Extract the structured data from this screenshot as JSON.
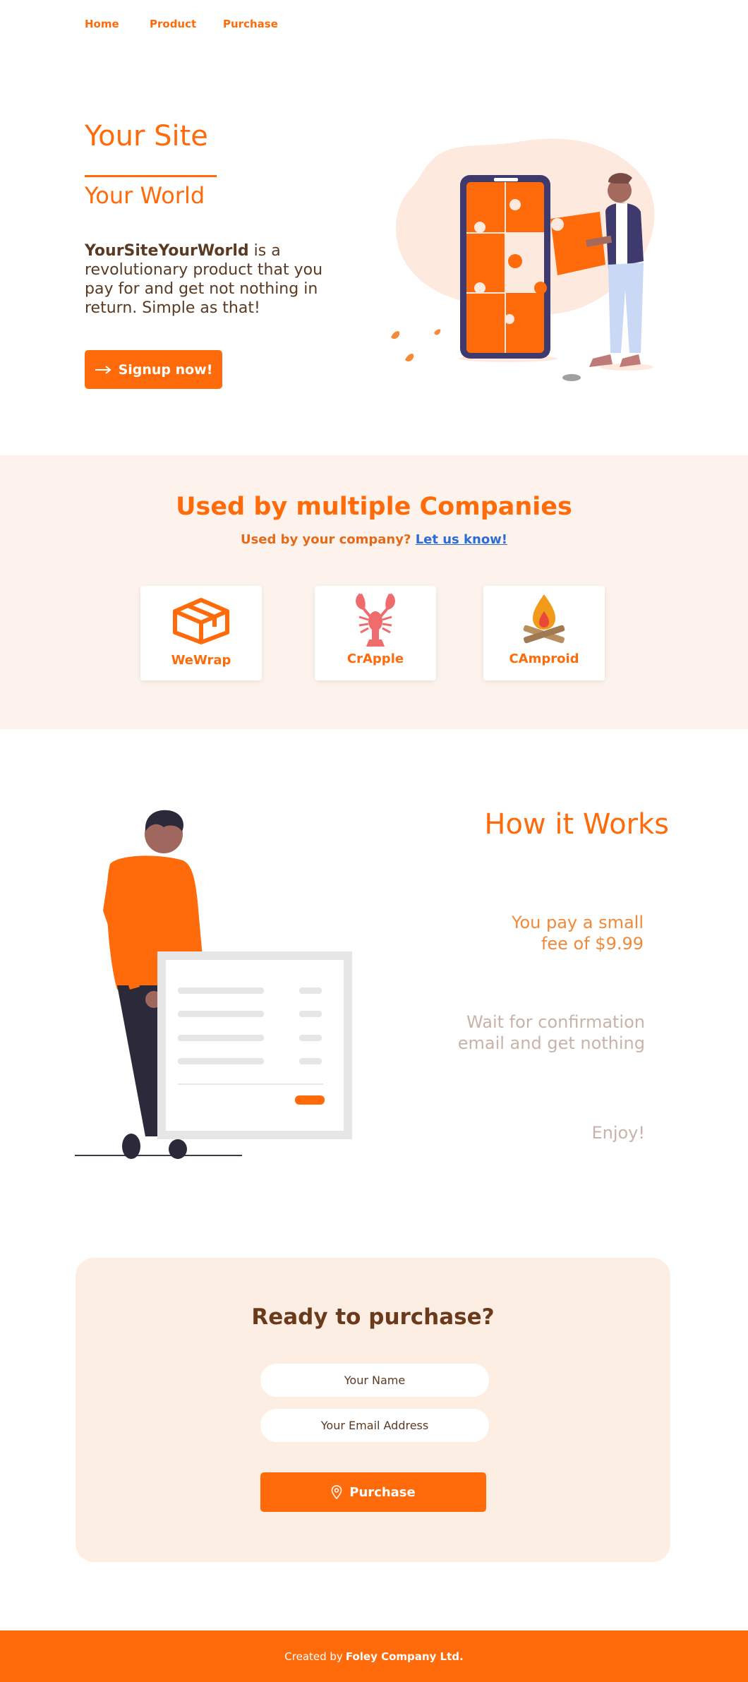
{
  "nav": {
    "items": [
      "Home",
      "Product",
      "Purchase"
    ]
  },
  "hero": {
    "title": "Your Site",
    "subtitle": "Your World",
    "brand": "YourSiteYourWorld",
    "description": " is a revolutionary product that you pay for and get not nothing in return. Simple as that!",
    "cta_label": "Signup now!",
    "cta_icon": "long-arrow-right-icon"
  },
  "companies": {
    "title": "Used by multiple Companies",
    "subtitle": "Used by your company?",
    "link_label": "Let us know!",
    "items": [
      {
        "name": "WeWrap",
        "icon": "box-icon"
      },
      {
        "name": "CrApple",
        "icon": "lobster-icon"
      },
      {
        "name": "CAmproid",
        "icon": "campfire-icon"
      }
    ]
  },
  "how": {
    "title": "How it Works",
    "steps": [
      {
        "line1": "You pay a small",
        "line2": "fee of $9.99"
      },
      {
        "line1": "Wait for confirmation",
        "line2": "email and get nothing"
      },
      {
        "line1": "Enjoy!"
      }
    ]
  },
  "purchase": {
    "title": "Ready to purchase?",
    "name_placeholder": "Your Name",
    "email_placeholder": "Your Email Address",
    "button_label": "Purchase",
    "button_icon": "map-pin-icon"
  },
  "footer": {
    "prefix": "Created by",
    "company": "Foley Company Ltd."
  },
  "colors": {
    "accent": "#ff6a0a",
    "band_bg": "#fdf3ec",
    "panel_bg": "#fdeee4",
    "text_brown": "#5a3a22",
    "step_light": "#c9b3a8",
    "link": "#2d6bd6"
  }
}
